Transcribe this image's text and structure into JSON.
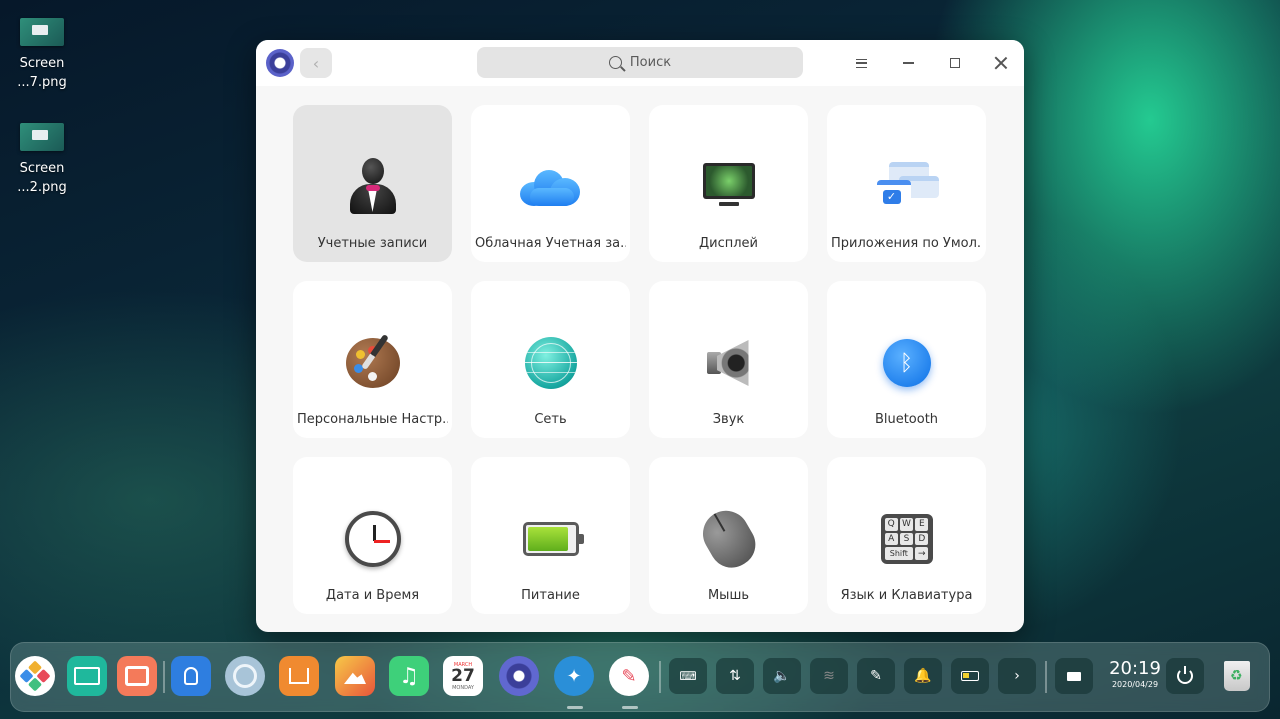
{
  "desktop": {
    "files": [
      {
        "line1": "Screen",
        "line2": "...7.png"
      },
      {
        "line1": "Screen",
        "line2": "...2.png"
      }
    ]
  },
  "window": {
    "search_placeholder": "Поиск",
    "tiles": [
      {
        "label": "Учетные записи",
        "icon": "accounts-icon",
        "active": true
      },
      {
        "label": "Облачная Учетная за...",
        "icon": "cloud-icon"
      },
      {
        "label": "Дисплей",
        "icon": "display-icon"
      },
      {
        "label": "Приложения по Умол...",
        "icon": "default-apps-icon"
      },
      {
        "label": "Персональные Настр...",
        "icon": "palette-icon"
      },
      {
        "label": "Сеть",
        "icon": "network-icon"
      },
      {
        "label": "Звук",
        "icon": "speaker-icon"
      },
      {
        "label": "Bluetooth",
        "icon": "bluetooth-icon"
      },
      {
        "label": "Дата и Время",
        "icon": "clock-icon"
      },
      {
        "label": "Питание",
        "icon": "battery-icon"
      },
      {
        "label": "Мышь",
        "icon": "mouse-icon"
      },
      {
        "label": "Язык и  Клавиатура",
        "icon": "keyboard-icon"
      }
    ]
  },
  "keyboard_icon_keys": [
    "Q",
    "W",
    "E",
    "A",
    "S",
    "D",
    "Shift",
    "→"
  ],
  "calendar_icon": {
    "month": "MARCH",
    "day": "27",
    "weekday": "MONDAY"
  },
  "dock": {
    "time": "20:19",
    "date": "2020/04/29",
    "accent": "#1aa99a"
  }
}
